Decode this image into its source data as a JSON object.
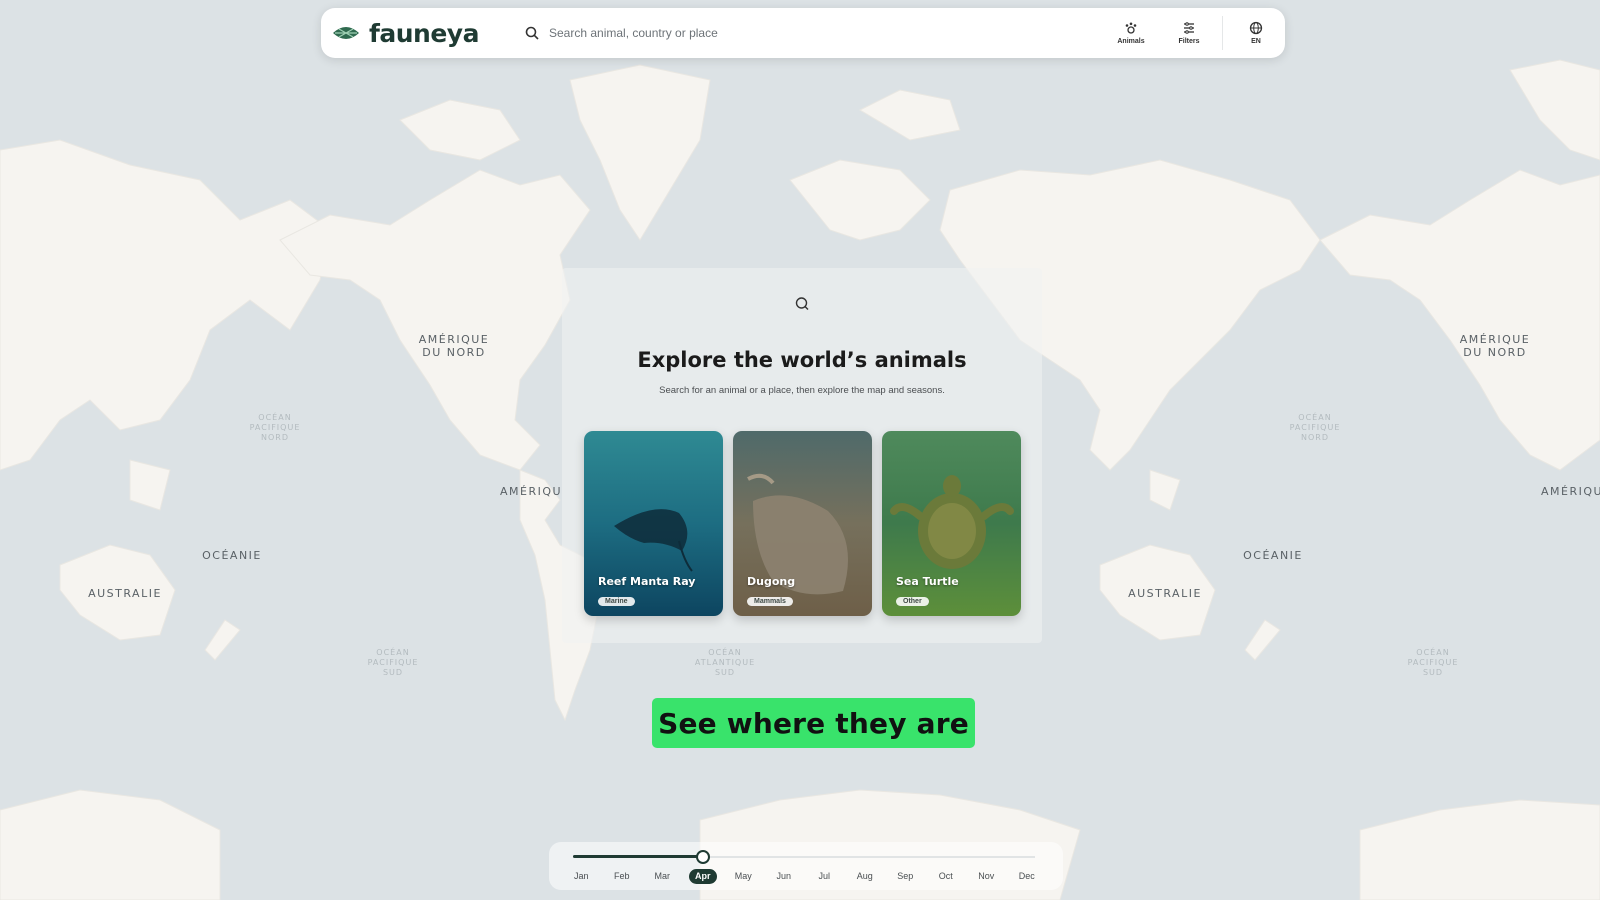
{
  "app": {
    "brand": "fauneya",
    "accent_color": "#1f3b33",
    "cta_color": "#39e36b"
  },
  "search": {
    "placeholder": "Search animal, country or place",
    "icon": "search-icon"
  },
  "nav": [
    {
      "label": "Animals",
      "icon": "paw-icon"
    },
    {
      "label": "Filters",
      "icon": "filter-icon"
    },
    {
      "label": "EN",
      "icon": "globe-icon"
    }
  ],
  "map": {
    "labels": {
      "na_left": "AMÉRIQUE\nDU NORD",
      "na_right": "AMÉRIQUE\nDU NORD",
      "sa_left": "AMÉRIQU",
      "sa_right": "AMÉRIQU",
      "oceania_left": "OCÉANIE",
      "oceania_right": "OCÉANIE",
      "australia_left": "AUSTRALIE",
      "australia_right": "AUSTRALIE"
    },
    "ocean_labels": {
      "pacific_n_left": "OCÉAN\nPACIFIQUE\nNORD",
      "pacific_n_right": "OCÉAN\nPACIFIQUE\nNORD",
      "pacific_s_left": "OCÉAN\nPACIFIQUE\nSUD",
      "atlantic_s": "OCÉAN\nATLANTIQUE\nSUD",
      "pacific_s_right": "OCÉAN\nPACIFIQUE\nSUD"
    }
  },
  "panel": {
    "title": "Explore the world’s animals",
    "subtitle": "Search for an animal or a place, then explore the map and seasons.",
    "cards": [
      {
        "name": "Reef Manta Ray",
        "tag": "Marine"
      },
      {
        "name": "Dugong",
        "tag": "Mammals"
      },
      {
        "name": "Sea Turtle",
        "tag": "Other"
      }
    ]
  },
  "cta": {
    "label": "See where they are"
  },
  "timeline": {
    "months": [
      "Jan",
      "Feb",
      "Mar",
      "Apr",
      "May",
      "Jun",
      "Jul",
      "Aug",
      "Sep",
      "Oct",
      "Nov",
      "Dec"
    ],
    "selected_index": 3
  }
}
